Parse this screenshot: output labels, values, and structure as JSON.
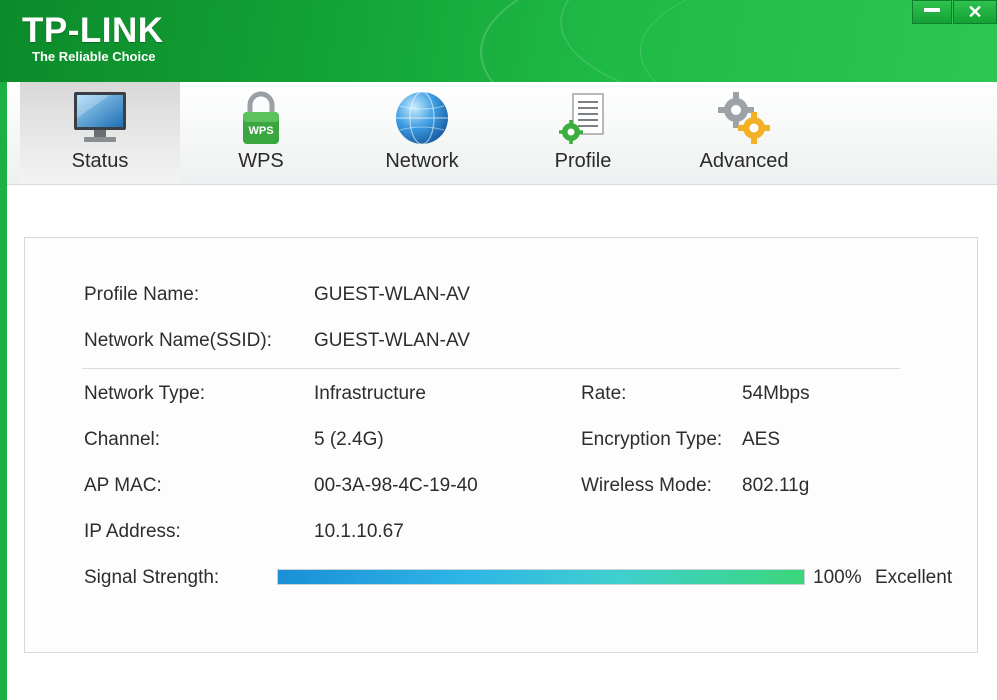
{
  "brand": {
    "name": "TP-LINK",
    "tagline": "The Reliable Choice"
  },
  "window_controls": {
    "minimize_icon": "minimize-icon",
    "close_icon": "close-icon",
    "close_glyph": "✕"
  },
  "tabs": [
    {
      "label": "Status",
      "icon": "monitor-icon",
      "active": true
    },
    {
      "label": "WPS",
      "icon": "wps-lock-icon",
      "active": false
    },
    {
      "label": "Network",
      "icon": "globe-icon",
      "active": false
    },
    {
      "label": "Profile",
      "icon": "profile-document-icon",
      "active": false
    },
    {
      "label": "Advanced",
      "icon": "gears-icon",
      "active": false
    }
  ],
  "status": {
    "profile_name_label": "Profile Name:",
    "profile_name_value": "GUEST-WLAN-AV",
    "ssid_label": "Network Name(SSID):",
    "ssid_value": "GUEST-WLAN-AV",
    "network_type_label": "Network Type:",
    "network_type_value": "Infrastructure",
    "channel_label": "Channel:",
    "channel_value": "5 (2.4G)",
    "ap_mac_label": "AP MAC:",
    "ap_mac_value": "00-3A-98-4C-19-40",
    "ip_label": "IP Address:",
    "ip_value": "10.1.10.67",
    "rate_label": "Rate:",
    "rate_value": "54Mbps",
    "encryption_label": "Encryption Type:",
    "encryption_value": "AES",
    "mode_label": "Wireless Mode:",
    "mode_value": "802.11g",
    "signal_label": "Signal Strength:",
    "signal_percent_text": "100%",
    "signal_quality": "Excellent",
    "signal_level": 1.0
  },
  "colors": {
    "brand_green": "#13a437",
    "signal_blue": "#1b8fd6",
    "signal_green": "#3bd67a"
  }
}
